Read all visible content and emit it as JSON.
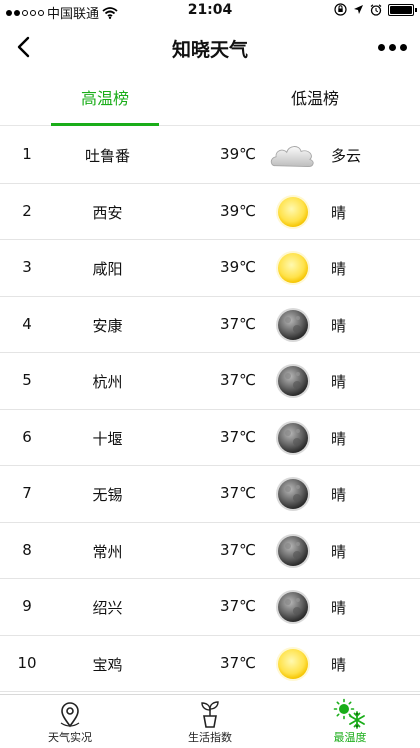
{
  "status": {
    "carrier": "中国联通",
    "time": "21:04",
    "battery_fill": 1.0
  },
  "nav": {
    "title": "知晓天气"
  },
  "tabs": [
    {
      "label": "高温榜",
      "active": true
    },
    {
      "label": "低温榜",
      "active": false
    }
  ],
  "rows": [
    {
      "rank": "1",
      "city": "吐鲁番",
      "temp": "39℃",
      "icon": "cloud-icon",
      "cond": "多云"
    },
    {
      "rank": "2",
      "city": "西安",
      "temp": "39℃",
      "icon": "sun-icon",
      "cond": "晴"
    },
    {
      "rank": "3",
      "city": "咸阳",
      "temp": "39℃",
      "icon": "sun-icon",
      "cond": "晴"
    },
    {
      "rank": "4",
      "city": "安康",
      "temp": "37℃",
      "icon": "moon-icon",
      "cond": "晴"
    },
    {
      "rank": "5",
      "city": "杭州",
      "temp": "37℃",
      "icon": "moon-icon",
      "cond": "晴"
    },
    {
      "rank": "6",
      "city": "十堰",
      "temp": "37℃",
      "icon": "moon-icon",
      "cond": "晴"
    },
    {
      "rank": "7",
      "city": "无锡",
      "temp": "37℃",
      "icon": "moon-icon",
      "cond": "晴"
    },
    {
      "rank": "8",
      "city": "常州",
      "temp": "37℃",
      "icon": "moon-icon",
      "cond": "晴"
    },
    {
      "rank": "9",
      "city": "绍兴",
      "temp": "37℃",
      "icon": "moon-icon",
      "cond": "晴"
    },
    {
      "rank": "10",
      "city": "宝鸡",
      "temp": "37℃",
      "icon": "sun-icon",
      "cond": "晴"
    }
  ],
  "tabbar": [
    {
      "label": "天气实况",
      "icon": "location-pin-icon",
      "active": false
    },
    {
      "label": "生活指数",
      "icon": "plant-pot-icon",
      "active": false
    },
    {
      "label": "最温度",
      "icon": "sun-snow-icon",
      "active": true
    }
  ],
  "colors": {
    "accent": "#1aad19"
  }
}
